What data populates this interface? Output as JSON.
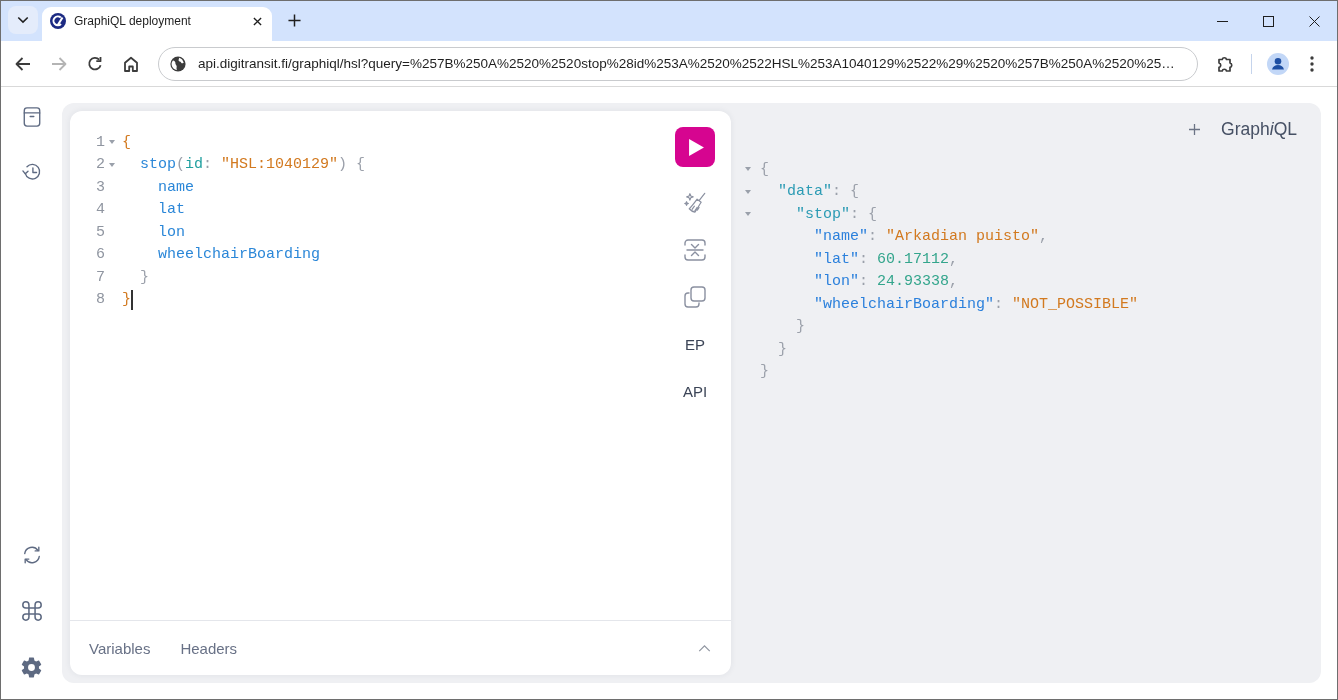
{
  "browser": {
    "tabs": [
      {
        "title": "GraphiQL deployment",
        "selected": true
      }
    ],
    "nav_buttons": [
      {
        "kind": "back",
        "disabled": false
      },
      {
        "kind": "forward",
        "disabled": true
      },
      {
        "kind": "reload",
        "disabled": false
      },
      {
        "kind": "home",
        "disabled": false
      }
    ],
    "address_bar": {
      "url": "api.digitransit.fi/graphiql/hsl?query=%257B%250A%2520%2520stop%28id%253A%2520%2522HSL%253A1040129%2522%29%2520%257B%250A%2520%25…"
    }
  },
  "sidebar": {
    "top_buttons": [
      {
        "kind": "docs",
        "selected": false
      },
      {
        "kind": "history",
        "selected": false
      }
    ],
    "bottom_buttons": [
      {
        "kind": "refetch"
      },
      {
        "kind": "shortcuts"
      },
      {
        "kind": "settings"
      }
    ]
  },
  "query_editor": {
    "lines": [
      {
        "number": "1",
        "foldable": true,
        "cursor": false,
        "tokens": [
          {
            "kind": "bracket-match",
            "text": "{"
          }
        ],
        "children": [
          {
            "number": "2",
            "foldable": true,
            "cursor": false,
            "tokens": [
              {
                "kind": "field",
                "text": "stop"
              },
              {
                "kind": "punct",
                "text": "("
              },
              {
                "kind": "argument",
                "text": "id"
              },
              {
                "kind": "punct",
                "text": ": "
              },
              {
                "kind": "string",
                "text": "\"HSL:1040129\""
              },
              {
                "kind": "punct",
                "text": ") {"
              }
            ],
            "children": [
              {
                "number": "3",
                "foldable": false,
                "cursor": false,
                "tokens": [
                  {
                    "kind": "field",
                    "text": "name"
                  }
                ]
              },
              {
                "number": "4",
                "foldable": false,
                "cursor": false,
                "tokens": [
                  {
                    "kind": "field",
                    "text": "lat"
                  }
                ]
              },
              {
                "number": "5",
                "foldable": false,
                "cursor": false,
                "tokens": [
                  {
                    "kind": "field",
                    "text": "lon"
                  }
                ]
              },
              {
                "number": "6",
                "foldable": false,
                "cursor": false,
                "tokens": [
                  {
                    "kind": "field",
                    "text": "wheelchairBoarding"
                  }
                ]
              }
            ]
          },
          {
            "number": "7",
            "foldable": false,
            "cursor": false,
            "tokens": [
              {
                "kind": "punct",
                "text": "}"
              }
            ]
          }
        ]
      },
      {
        "number": "8",
        "foldable": false,
        "cursor": true,
        "tokens": [
          {
            "kind": "bracket-match",
            "text": "}"
          }
        ]
      }
    ],
    "toolbar": [
      {
        "kind": "run"
      },
      {
        "kind": "prettify"
      },
      {
        "kind": "merge"
      },
      {
        "kind": "copy"
      },
      {
        "kind": "text",
        "label": "EP"
      },
      {
        "kind": "text",
        "label": "API"
      }
    ],
    "bottom_panel": {
      "tabs": [
        {
          "label": "Variables",
          "selected": false
        },
        {
          "label": "Headers",
          "selected": false
        }
      ],
      "expanded": false
    }
  },
  "result": {
    "logo": [
      {
        "text": "Graph",
        "italic": false
      },
      {
        "text": "i",
        "italic": true
      },
      {
        "text": "QL",
        "italic": false
      }
    ],
    "lines": [
      {
        "foldable": true,
        "tokens": [
          {
            "kind": "punct",
            "text": "{"
          }
        ],
        "children": [
          {
            "foldable": true,
            "tokens": [
              {
                "kind": "object-key",
                "text": "\"data\""
              },
              {
                "kind": "punct",
                "text": ": {"
              }
            ],
            "children": [
              {
                "foldable": true,
                "tokens": [
                  {
                    "kind": "object-key",
                    "text": "\"stop\""
                  },
                  {
                    "kind": "punct",
                    "text": ": {"
                  }
                ],
                "children": [
                  {
                    "foldable": false,
                    "tokens": [
                      {
                        "kind": "key",
                        "text": "\"name\""
                      },
                      {
                        "kind": "punct",
                        "text": ": "
                      },
                      {
                        "kind": "string",
                        "text": "\"Arkadian puisto\""
                      },
                      {
                        "kind": "punct",
                        "text": ","
                      }
                    ]
                  },
                  {
                    "foldable": false,
                    "tokens": [
                      {
                        "kind": "key",
                        "text": "\"lat\""
                      },
                      {
                        "kind": "punct",
                        "text": ": "
                      },
                      {
                        "kind": "number",
                        "text": "60.17112"
                      },
                      {
                        "kind": "punct",
                        "text": ","
                      }
                    ]
                  },
                  {
                    "foldable": false,
                    "tokens": [
                      {
                        "kind": "key",
                        "text": "\"lon\""
                      },
                      {
                        "kind": "punct",
                        "text": ": "
                      },
                      {
                        "kind": "number",
                        "text": "24.93338"
                      },
                      {
                        "kind": "punct",
                        "text": ","
                      }
                    ]
                  },
                  {
                    "foldable": false,
                    "tokens": [
                      {
                        "kind": "key",
                        "text": "\"wheelchairBoarding\""
                      },
                      {
                        "kind": "punct",
                        "text": ": "
                      },
                      {
                        "kind": "string",
                        "text": "\"NOT_POSSIBLE\""
                      }
                    ]
                  }
                ]
              },
              {
                "foldable": false,
                "tokens": [
                  {
                    "kind": "punct",
                    "text": "}"
                  }
                ]
              }
            ]
          },
          {
            "foldable": false,
            "tokens": [
              {
                "kind": "punct",
                "text": "}"
              }
            ]
          }
        ]
      },
      {
        "foldable": false,
        "tokens": [
          {
            "kind": "punct",
            "text": "}"
          }
        ]
      }
    ]
  }
}
